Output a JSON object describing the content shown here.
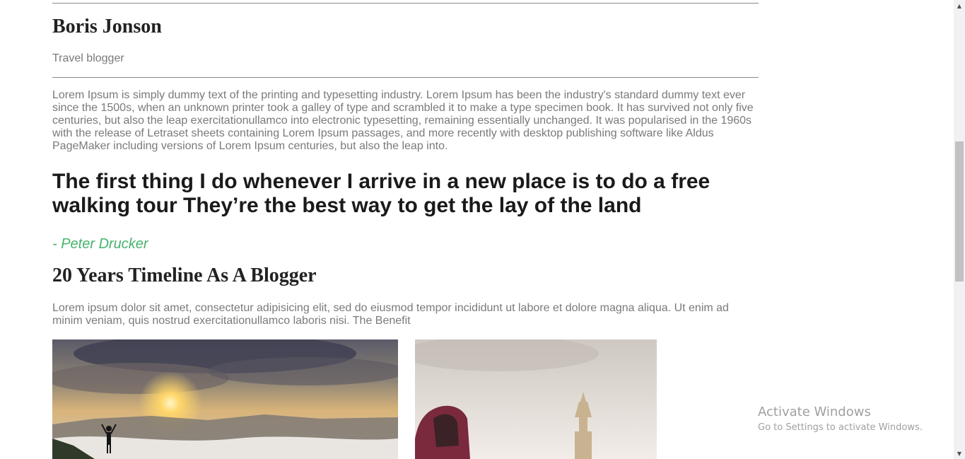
{
  "author": {
    "name": "Boris Jonson",
    "role": "Travel blogger"
  },
  "bio": "Lorem Ipsum is simply dummy text of the printing and typesetting industry. Lorem Ipsum has been the industry's standard dummy text ever since the 1500s, when an unknown printer took a galley of type and scrambled it to make a type specimen book. It has survived not only five centuries, but also the leap exercitationullamco into electronic typesetting, remaining essentially unchanged. It was popularised in the 1960s with the release of Letraset sheets containing Lorem Ipsum passages, and more recently with desktop publishing software like Aldus PageMaker including versions of Lorem Ipsum centuries, but also the leap into.",
  "quote": {
    "text": "The first thing I do whenever I arrive in a new place is to do a free walking tour They’re the best way to get the lay of the land",
    "author": "- Peter Drucker",
    "author_color": "#45b36b"
  },
  "timeline": {
    "title": "20 Years Timeline As A Blogger",
    "text": "Lorem ipsum dolor sit amet, consectetur adipisicing elit, sed do eiusmod tempor incididunt ut labore et dolore magna aliqua. Ut enim ad minim veniam, quis nostrud exercitationullamco laboris nisi. The Benefit"
  },
  "watermark": {
    "title": "Activate Windows",
    "subtitle": "Go to Settings to activate Windows."
  },
  "icons": {
    "scroll_up": "scroll-up-arrow-icon",
    "scroll_down": "scroll-down-arrow-icon"
  }
}
